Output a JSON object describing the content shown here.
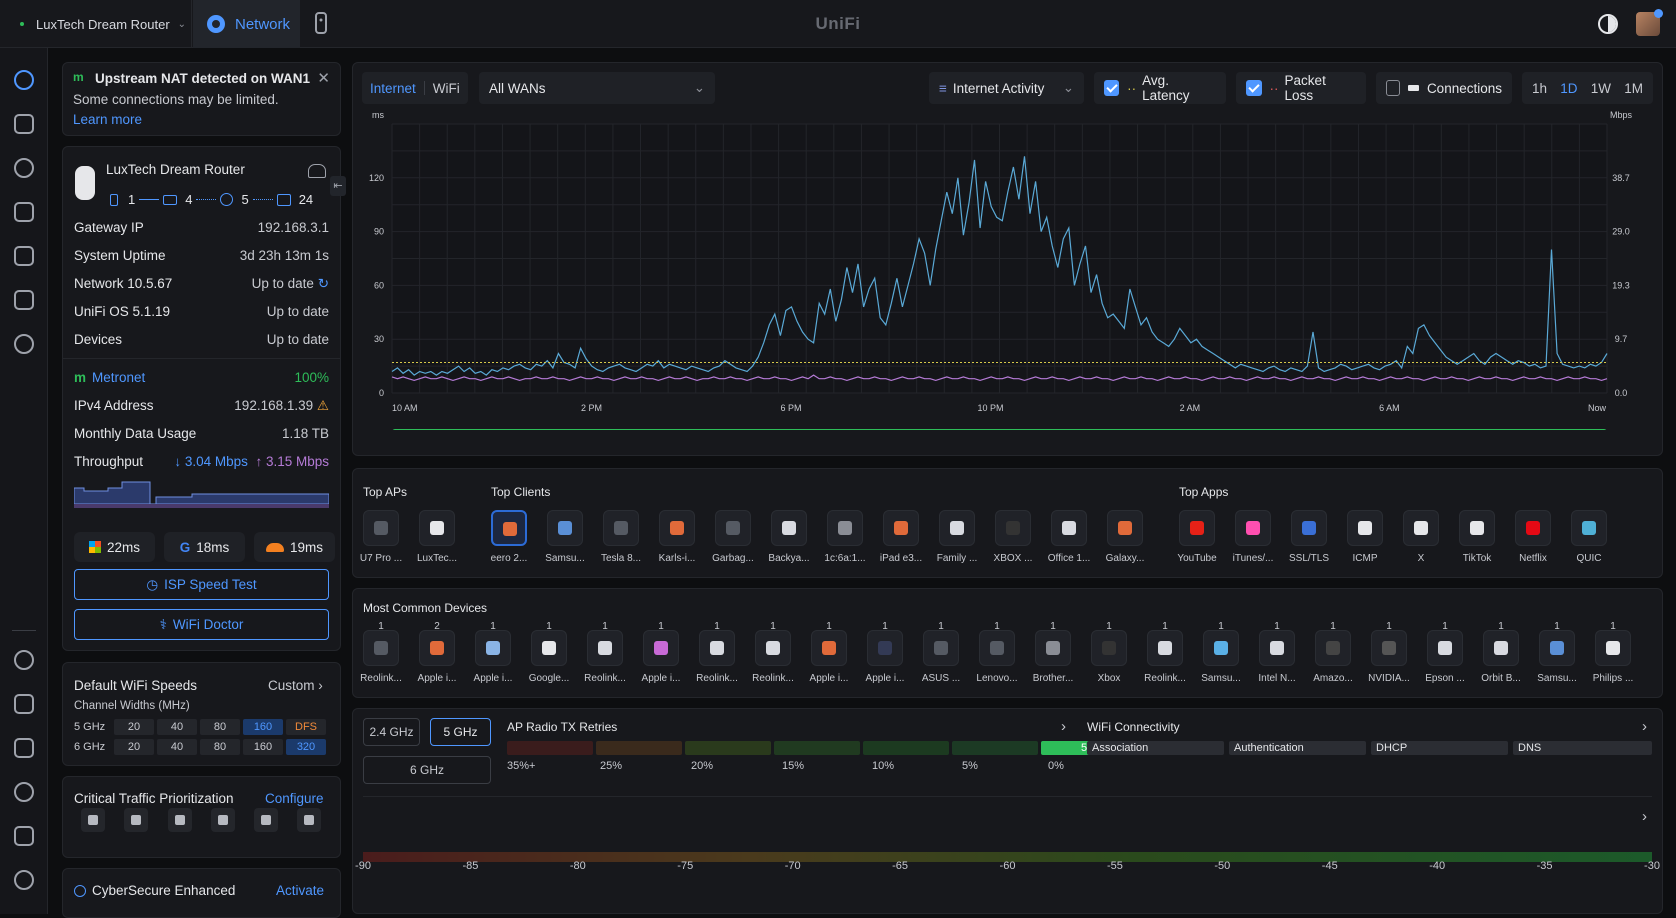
{
  "topbar": {
    "device_name": "LuxTech Dream Router",
    "tab_network": "Network",
    "brand": "UniFi"
  },
  "alert": {
    "title": "Upstream NAT detected on WAN1",
    "body": "Some connections may be limited.",
    "link": "Learn more"
  },
  "router": {
    "name": "LuxTech Dream Router",
    "topology": [
      "1",
      "4",
      "5",
      "24"
    ],
    "rows": [
      {
        "label": "Gateway IP",
        "value": "192.168.3.1"
      },
      {
        "label": "System Uptime",
        "value": "3d 23h 13m 1s"
      },
      {
        "label": "Network 10.5.67",
        "value": "Up to date"
      },
      {
        "label": "UniFi OS 5.1.19",
        "value": "Up to date"
      },
      {
        "label": "Devices",
        "value": "Up to date"
      }
    ]
  },
  "isp": {
    "name": "Metronet",
    "health": "100%",
    "rows": [
      {
        "label": "IPv4 Address",
        "value": "192.168.1.39"
      },
      {
        "label": "Monthly Data Usage",
        "value": "1.18 TB"
      }
    ],
    "throughput_label": "Throughput",
    "down": "3.04 Mbps",
    "up": "3.15 Mbps",
    "latencies": [
      {
        "provider": "windows",
        "value": "22ms"
      },
      {
        "provider": "google",
        "value": "18ms"
      },
      {
        "provider": "cloudflare",
        "value": "19ms"
      }
    ],
    "speed_test_button": "ISP Speed Test",
    "wifi_doctor_button": "WiFi Doctor"
  },
  "wifi_speeds": {
    "title": "Default WiFi Speeds",
    "mode": "Custom",
    "subtitle": "Channel Widths (MHz)",
    "bands": [
      {
        "name": "5 GHz",
        "widths": [
          "20",
          "40",
          "80",
          "160",
          "DFS"
        ],
        "selected": [
          3,
          4
        ]
      },
      {
        "name": "6 GHz",
        "widths": [
          "20",
          "40",
          "80",
          "160",
          "320"
        ],
        "selected": [
          4
        ]
      }
    ]
  },
  "traffic": {
    "title": "Critical Traffic Prioritization",
    "action": "Configure"
  },
  "cybersecure": {
    "title": "CyberSecure Enhanced",
    "action": "Activate"
  },
  "chart_controls": {
    "tabs": [
      "Internet",
      "WiFi"
    ],
    "wan_select": "All WANs",
    "metric_select": "Internet Activity",
    "avg_latency": "Avg. Latency",
    "packet_loss": "Packet Loss",
    "connections": "Connections",
    "ranges": [
      "1h",
      "1D",
      "1W",
      "1M"
    ],
    "active_range": "1D"
  },
  "chart_data": {
    "type": "line",
    "ylabel": "ms",
    "y2label": "Mbps",
    "ylim": [
      0,
      150
    ],
    "y_ticks": [
      "0",
      "30",
      "60",
      "90",
      "120"
    ],
    "y2_ticks": [
      "0.0",
      "9.7",
      "19.3",
      "29.0",
      "38.7"
    ],
    "x_ticks": [
      "10 AM",
      "2 PM",
      "6 PM",
      "10 PM",
      "2 AM",
      "6 AM",
      "Now"
    ],
    "series": [
      {
        "color": "#5aa9d6",
        "values": [
          12,
          14,
          11,
          13,
          10,
          12,
          11,
          12,
          10,
          12,
          11,
          13,
          15,
          12,
          14,
          11,
          12,
          10,
          13,
          12,
          14,
          13,
          15,
          16,
          14,
          13,
          16,
          15,
          18,
          14,
          22,
          17,
          16,
          14,
          25,
          19,
          15,
          13,
          12,
          14,
          15,
          16,
          14,
          13,
          12,
          14,
          16,
          15,
          18,
          14,
          16,
          15,
          14,
          13,
          15,
          14,
          13,
          12,
          14,
          15,
          18,
          16,
          14,
          13,
          12,
          15,
          20,
          28,
          38,
          44,
          32,
          46,
          48,
          40,
          34,
          30,
          28,
          50,
          44,
          58,
          40,
          52,
          70,
          56,
          72,
          48,
          58,
          64,
          42,
          38,
          50,
          64,
          48,
          60,
          72,
          86,
          78,
          60,
          80,
          96,
          112,
          100,
          120,
          88,
          106,
          130,
          92,
          118,
          104,
          98,
          96,
          112,
          126,
          108,
          132,
          100,
          118,
          90,
          98,
          82,
          70,
          86,
          92,
          60,
          72,
          82,
          56,
          66,
          50,
          42,
          44,
          40,
          36,
          58,
          48,
          38,
          42,
          34,
          30,
          28,
          26,
          30,
          36,
          32,
          28,
          30,
          26,
          24,
          22,
          20,
          18,
          16,
          14,
          16,
          15,
          14,
          13,
          12,
          14,
          15,
          13,
          12,
          14,
          13,
          12,
          15,
          34,
          14,
          12,
          13,
          14,
          16,
          15,
          13,
          14,
          15,
          16,
          14,
          13,
          15,
          16,
          18,
          14,
          26,
          22,
          36,
          38,
          32,
          28,
          24,
          20,
          18,
          16,
          18,
          20,
          22,
          18,
          16,
          20,
          22,
          20,
          18,
          16,
          18,
          17,
          15,
          16,
          14,
          15,
          80,
          22,
          16,
          15,
          14,
          15,
          14,
          16,
          15,
          17,
          22
        ]
      },
      {
        "color": "#b57bd6",
        "values": [
          9,
          8,
          9,
          8,
          7,
          8,
          9,
          8,
          8,
          9,
          8,
          7,
          8,
          9,
          8,
          8,
          7,
          8,
          9,
          8,
          8,
          9,
          8,
          7,
          8,
          8,
          9,
          8,
          8,
          9,
          8,
          8,
          7,
          8,
          9,
          8,
          8,
          9,
          8,
          8,
          7,
          8,
          9,
          8,
          8,
          9,
          8,
          8,
          7,
          8,
          9,
          8,
          8,
          9,
          8,
          7,
          8,
          8,
          9,
          8,
          8,
          9,
          8,
          8,
          7,
          8,
          9,
          8,
          8,
          9,
          8,
          8,
          7,
          8,
          9,
          8,
          10,
          8,
          8,
          9,
          8,
          8,
          7,
          8,
          9,
          8,
          8,
          9,
          8,
          8,
          7,
          8,
          9,
          8,
          8,
          9,
          8,
          8,
          7,
          8,
          9,
          8,
          8,
          9,
          8,
          8,
          7,
          8,
          9,
          8,
          8,
          9,
          8,
          8,
          7,
          8,
          9,
          8,
          8,
          9,
          8,
          8,
          7,
          8,
          9,
          8,
          8,
          9,
          8,
          8,
          7,
          8,
          9,
          8,
          8,
          9,
          8,
          8,
          7,
          8,
          9,
          8,
          8,
          9,
          8,
          8,
          7,
          8,
          9,
          8,
          8,
          9,
          8,
          8,
          7,
          8,
          9,
          8,
          8,
          9,
          8,
          8,
          7,
          8,
          9,
          8,
          8,
          9,
          8,
          8,
          7,
          8,
          9,
          8,
          8,
          9,
          8,
          8,
          7,
          8,
          9,
          8,
          8,
          9,
          8,
          8,
          7,
          8,
          9,
          8,
          8,
          9,
          8,
          8,
          7,
          8,
          9,
          8,
          8,
          9,
          8,
          8,
          7,
          8,
          9,
          8,
          8,
          9,
          8,
          8,
          7,
          8,
          9,
          8,
          8,
          9,
          8,
          8,
          7,
          8
        ]
      },
      {
        "color": "#d6c84a",
        "values": [
          17,
          17,
          17,
          17,
          17,
          17,
          17,
          17,
          17,
          17,
          17,
          17,
          17,
          17,
          17,
          17,
          17,
          17,
          17,
          17,
          17,
          17,
          17,
          17,
          17,
          17,
          17,
          17,
          17,
          17,
          17,
          17,
          17,
          17,
          17,
          17,
          17,
          17,
          17,
          17,
          17,
          17,
          17,
          17
        ]
      }
    ]
  },
  "top": {
    "aps_title": "Top APs",
    "clients_title": "Top Clients",
    "apps_title": "Top Apps",
    "aps": [
      {
        "label": "U7 Pro ...",
        "icon": "ap-icon"
      },
      {
        "label": "LuxTec...",
        "icon": "router-icon"
      }
    ],
    "clients": [
      {
        "label": "eero 2...",
        "icon": "phone-icon"
      },
      {
        "label": "Samsu...",
        "icon": "tv-icon"
      },
      {
        "label": "Tesla 8...",
        "icon": "car-icon"
      },
      {
        "label": "Karls-i...",
        "icon": "phone-icon"
      },
      {
        "label": "Garbag...",
        "icon": "car-icon"
      },
      {
        "label": "Backya...",
        "icon": "camera-icon"
      },
      {
        "label": "1c:6a:1...",
        "icon": "device-icon"
      },
      {
        "label": "iPad e3...",
        "icon": "tablet-icon"
      },
      {
        "label": "Family ...",
        "icon": "camera-icon"
      },
      {
        "label": "XBOX ...",
        "icon": "console-icon"
      },
      {
        "label": "Office 1...",
        "icon": "camera-icon"
      },
      {
        "label": "Galaxy...",
        "icon": "phone-icon"
      }
    ],
    "apps": [
      {
        "label": "YouTube",
        "icon": "youtube-icon",
        "color": "#e62117"
      },
      {
        "label": "iTunes/...",
        "icon": "itunes-icon",
        "color": "#ff4fb0"
      },
      {
        "label": "SSL/TLS",
        "icon": "shield-icon",
        "color": "#3a6fd6"
      },
      {
        "label": "ICMP",
        "icon": "network-icon",
        "color": "#e6e7ea"
      },
      {
        "label": "X",
        "icon": "x-icon",
        "color": "#e6e7ea"
      },
      {
        "label": "TikTok",
        "icon": "tiktok-icon",
        "color": "#e6e7ea"
      },
      {
        "label": "Netflix",
        "icon": "netflix-icon",
        "color": "#e50914"
      },
      {
        "label": "QUIC",
        "icon": "quic-icon",
        "color": "#4fb0d6"
      }
    ]
  },
  "common_devices": {
    "title": "Most Common Devices",
    "items": [
      {
        "count": "1",
        "label": "Reolink..."
      },
      {
        "count": "2",
        "label": "Apple i..."
      },
      {
        "count": "1",
        "label": "Apple i..."
      },
      {
        "count": "1",
        "label": "Google..."
      },
      {
        "count": "1",
        "label": "Reolink..."
      },
      {
        "count": "1",
        "label": "Apple i..."
      },
      {
        "count": "1",
        "label": "Reolink..."
      },
      {
        "count": "1",
        "label": "Reolink..."
      },
      {
        "count": "1",
        "label": "Apple i..."
      },
      {
        "count": "1",
        "label": "Apple i..."
      },
      {
        "count": "1",
        "label": "ASUS ..."
      },
      {
        "count": "1",
        "label": "Lenovo..."
      },
      {
        "count": "1",
        "label": "Brother..."
      },
      {
        "count": "1",
        "label": "Xbox"
      },
      {
        "count": "1",
        "label": "Reolink..."
      },
      {
        "count": "1",
        "label": "Samsu..."
      },
      {
        "count": "1",
        "label": "Intel N..."
      },
      {
        "count": "1",
        "label": "Amazo..."
      },
      {
        "count": "1",
        "label": "NVIDIA..."
      },
      {
        "count": "1",
        "label": "Epson ..."
      },
      {
        "count": "1",
        "label": "Orbit B..."
      },
      {
        "count": "1",
        "label": "Samsu..."
      },
      {
        "count": "1",
        "label": "Philips ..."
      }
    ]
  },
  "radio": {
    "bands": [
      "2.4 GHz",
      "5 GHz",
      "6 GHz"
    ],
    "selected_band": "5 GHz",
    "retries_title": "AP Radio TX Retries",
    "retry_labels": [
      "35%+",
      "25%",
      "20%",
      "15%",
      "10%",
      "5%",
      "0%"
    ],
    "retry_active_value": "5",
    "connectivity_title": "WiFi Connectivity",
    "connectivity_stages": [
      "Association",
      "Authentication",
      "DHCP",
      "DNS"
    ],
    "signal_scale": [
      "-90",
      "-85",
      "-80",
      "-75",
      "-70",
      "-65",
      "-60",
      "-55",
      "-50",
      "-45",
      "-40",
      "-35",
      "-30"
    ]
  }
}
